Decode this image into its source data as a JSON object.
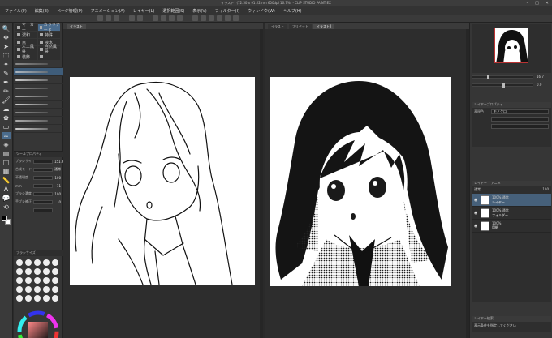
{
  "window": {
    "title": "イラスト* (72.50 x 91.22mm 600dpi 16.7%) - CLIP STUDIO PAINT EX",
    "controls": [
      "–",
      "□",
      "✕"
    ]
  },
  "menubar": [
    "ファイル(F)",
    "編集(E)",
    "ページ管理(P)",
    "アニメーション(A)",
    "レイヤー(L)",
    "選択範囲(S)",
    "表示(V)",
    "フィルター(I)",
    "ウィンドウ(W)",
    "ヘルプ(H)"
  ],
  "toolbox": {
    "tools": [
      {
        "icon": "zoom-icon",
        "glyph": "🔍"
      },
      {
        "icon": "move-icon",
        "glyph": "✥"
      },
      {
        "icon": "arrow-icon",
        "glyph": "➤"
      },
      {
        "icon": "select-icon",
        "glyph": "⬚"
      },
      {
        "icon": "wand-icon",
        "glyph": "✦"
      },
      {
        "icon": "eyedropper-icon",
        "glyph": "✎"
      },
      {
        "icon": "pen-icon",
        "glyph": "✒"
      },
      {
        "icon": "pencil-icon",
        "glyph": "✏"
      },
      {
        "icon": "brush-icon",
        "glyph": "🖌"
      },
      {
        "icon": "airbrush-icon",
        "glyph": "☁"
      },
      {
        "icon": "decoration-icon",
        "glyph": "✿"
      },
      {
        "icon": "eraser-icon",
        "glyph": "▭"
      },
      {
        "icon": "blend-icon",
        "glyph": "≈"
      },
      {
        "icon": "fill-icon",
        "glyph": "◈"
      },
      {
        "icon": "gradient-icon",
        "glyph": "▤"
      },
      {
        "icon": "figure-icon",
        "glyph": "□"
      },
      {
        "icon": "frame-icon",
        "glyph": "▦"
      },
      {
        "icon": "ruler-icon",
        "glyph": "📏"
      },
      {
        "icon": "text-icon",
        "glyph": "A"
      },
      {
        "icon": "balloon-icon",
        "glyph": "💬"
      },
      {
        "icon": "correct-line-icon",
        "glyph": "⟲"
      }
    ],
    "active_index": 12
  },
  "subtool_tabs": [
    {
      "label": "マーカー",
      "selected": false
    },
    {
      "label": "カラリアード",
      "selected": true
    },
    {
      "label": "濃和",
      "selected": false
    },
    {
      "label": "特殊",
      "selected": false
    },
    {
      "label": "点",
      "selected": false
    },
    {
      "label": "液水",
      "selected": false
    },
    {
      "label": "人工風景",
      "selected": false
    },
    {
      "label": "自然風景",
      "selected": false
    },
    {
      "label": "装飾",
      "selected": false
    },
    {
      "label": "",
      "selected": false
    }
  ],
  "brushes": [
    {
      "name": "",
      "selected": false
    },
    {
      "name": "",
      "selected": true
    },
    {
      "name": "",
      "selected": false
    },
    {
      "name": "",
      "selected": false
    },
    {
      "name": "",
      "selected": false
    },
    {
      "name": "",
      "selected": false
    },
    {
      "name": "",
      "selected": false
    },
    {
      "name": "",
      "selected": false
    },
    {
      "name": "",
      "selected": false
    }
  ],
  "tool_props": {
    "header": "ツールプロパティ",
    "rows": [
      {
        "label": "ブラシサイズ",
        "value": "151.6"
      },
      {
        "label": "合成モード",
        "value": "通常"
      },
      {
        "label": "不透明度",
        "value": "100"
      },
      {
        "label": "mm",
        "value": "11"
      },
      {
        "label": "ブラシ濃度",
        "value": "100"
      },
      {
        "label": "手ブレ補正",
        "value": "0"
      },
      {
        "label": "",
        "value": ""
      }
    ]
  },
  "brush_dots_header": "ブラシサイズ",
  "dot_count": 25,
  "canvas": {
    "left_tab": "イラスト",
    "right_tabs": [
      "イラスト",
      "プリセット",
      "イラスト2"
    ],
    "right_selected": 2
  },
  "navigator": {
    "zoom": "16.7",
    "rotate": "0.0"
  },
  "layer_props": {
    "header": "レイヤープロパティ",
    "rows": [
      {
        "label": "表現色",
        "value": "モノクロ"
      },
      {
        "label": "",
        "value": ""
      },
      {
        "label": "",
        "value": ""
      }
    ]
  },
  "layer_panel": {
    "tabs": [
      "レイヤー",
      "アニメ"
    ],
    "blend": "通常",
    "opacity": "100",
    "layers": [
      {
        "opacity": "100% 通常",
        "name": "レイヤー",
        "selected": true,
        "visible": true
      },
      {
        "opacity": "100% 通常",
        "name": "フォルダー",
        "selected": false,
        "visible": true
      },
      {
        "opacity": "100%",
        "name": "用紙",
        "selected": false,
        "visible": true
      }
    ]
  },
  "footer": {
    "header": "レイヤー検索",
    "message": "表示条件を指定してください"
  }
}
